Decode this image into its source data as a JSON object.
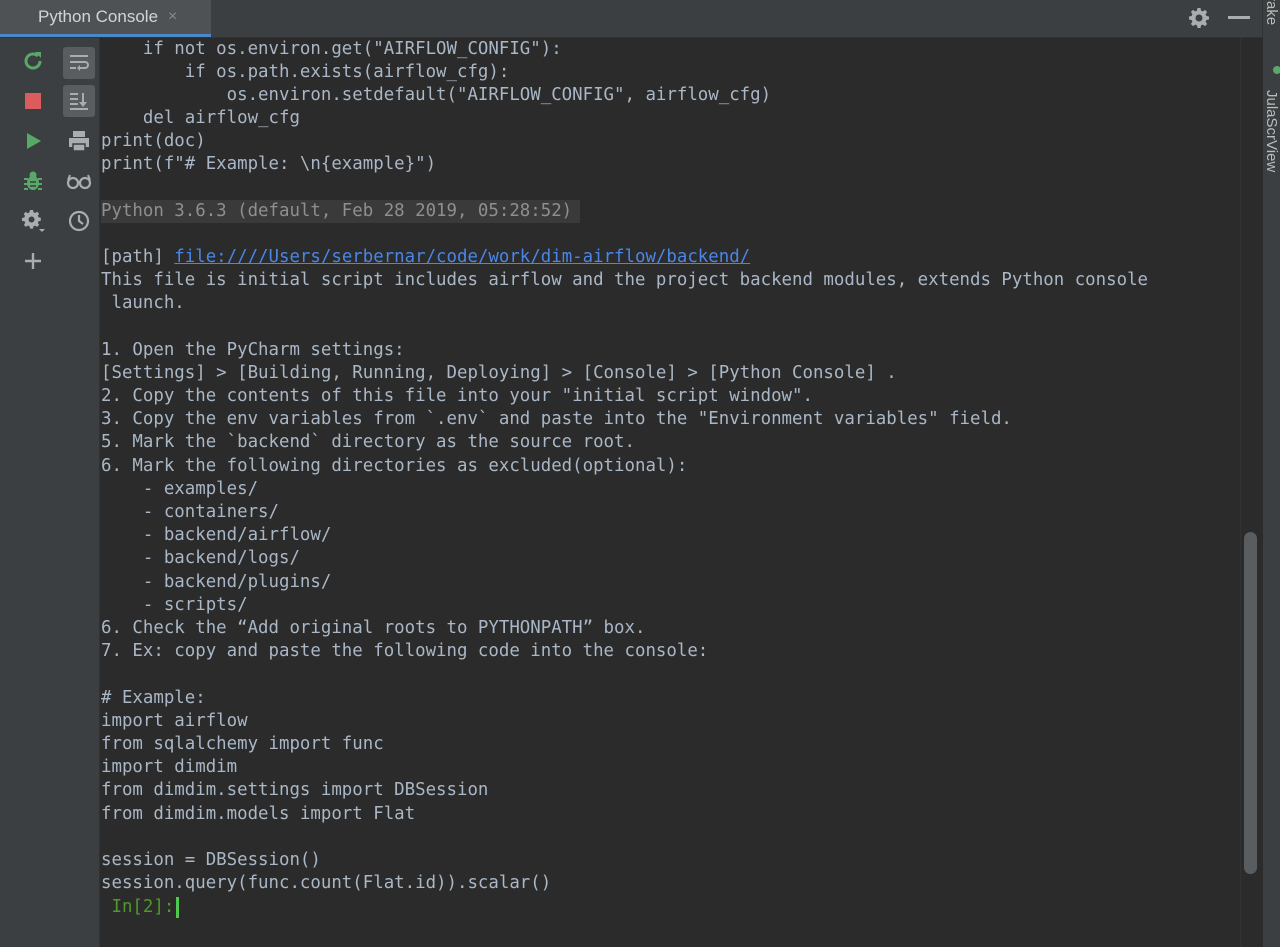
{
  "tab": {
    "label": "Python Console",
    "close": "×"
  },
  "right_stripe": {
    "top_text": "rake",
    "tool_text": "JulaScrView"
  },
  "toolbar_left": {
    "buttons": [
      "rerun-icon",
      "stop-icon",
      "run-icon",
      "debug-icon",
      "settings-icon",
      "add-icon"
    ]
  },
  "toolbar_right": {
    "buttons": [
      "soft-wrap-icon",
      "scroll-to-end-icon",
      "print-icon",
      "view-variables-icon",
      "history-icon"
    ]
  },
  "console": {
    "lines": [
      "    if not os.environ.get(\"AIRFLOW_CONFIG\"):",
      "        if os.path.exists(airflow_cfg):",
      "            os.environ.setdefault(\"AIRFLOW_CONFIG\", airflow_cfg)",
      "    del airflow_cfg",
      "print(doc)",
      "print(f\"# Example: \\n{example}\")"
    ],
    "version_line": "Python 3.6.3 (default, Feb 28 2019, 05:28:52)",
    "path_label": "[path] ",
    "path_link": "file:////Users/serbernar/code/work/dim-airflow/backend/",
    "body_lines": [
      "This file is initial script includes airflow and the project backend modules, extends Python console",
      " launch.",
      "",
      "1. Open the PyCharm settings:",
      "[Settings] > [Building, Running, Deploying] > [Console] > [Python Console] .",
      "2. Copy the contents of this file into your \"initial script window\".",
      "3. Copy the env variables from `.env` and paste into the \"Environment variables\" field.",
      "5. Mark the `backend` directory as the source root.",
      "6. Mark the following directories as excluded(optional):",
      "    - examples/",
      "    - containers/",
      "    - backend/airflow/",
      "    - backend/logs/",
      "    - backend/plugins/",
      "    - scripts/",
      "6. Check the “Add original roots to PYTHONPATH” box.",
      "7. Ex: copy and paste the following code into the console:",
      "",
      "# Example:",
      "import airflow",
      "from sqlalchemy import func",
      "import dimdim",
      "from dimdim.settings import DBSession",
      "from dimdim.models import Flat",
      "",
      "session = DBSession()",
      "session.query(func.count(Flat.id)).scalar()"
    ],
    "prompt": " In[2]:"
  },
  "colors": {
    "background": "#2b2b2b",
    "text": "#a9b7c6",
    "link": "#4a86e8",
    "prompt": "#4e9a2a"
  }
}
